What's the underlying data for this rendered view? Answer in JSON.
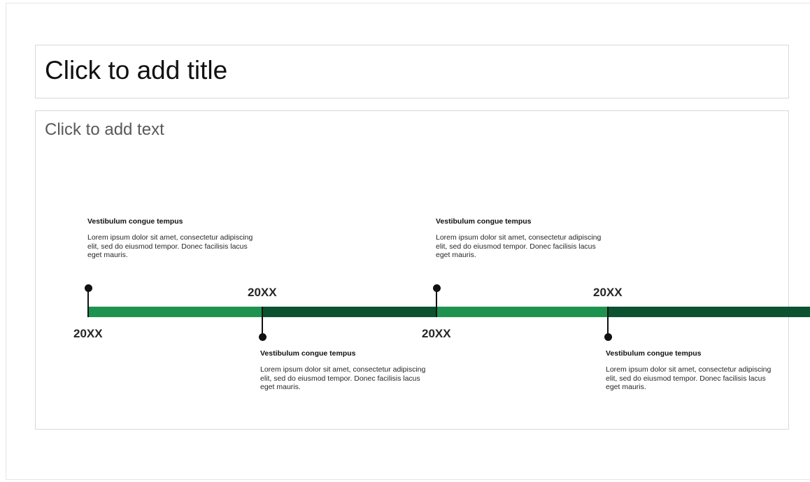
{
  "placeholders": {
    "title": "Click to add title",
    "body": "Click to add text"
  },
  "colors": {
    "accent_light": "#1e9350",
    "accent_dark": "#0d5230",
    "marker": "#111111"
  },
  "timeline": {
    "milestones": [
      {
        "year": "20XX",
        "heading": "Vestibulum congue tempus",
        "text": "Lorem ipsum dolor sit amet, consectetur adipiscing elit, sed do eiusmod tempor. Donec facilisis lacus eget mauris."
      },
      {
        "year": "20XX",
        "heading": "Vestibulum congue tempus",
        "text": "Lorem ipsum dolor sit amet, consectetur adipiscing elit, sed do eiusmod tempor. Donec facilisis lacus eget mauris."
      },
      {
        "year": "20XX",
        "heading": "Vestibulum congue tempus",
        "text": "Lorem ipsum dolor sit amet, consectetur adipiscing elit, sed do eiusmod tempor. Donec facilisis lacus eget mauris."
      },
      {
        "year": "20XX",
        "heading": "Vestibulum congue tempus",
        "text": "Lorem ipsum dolor sit amet, consectetur adipiscing elit, sed do eiusmod tempor. Donec facilisis lacus eget mauris."
      }
    ]
  }
}
